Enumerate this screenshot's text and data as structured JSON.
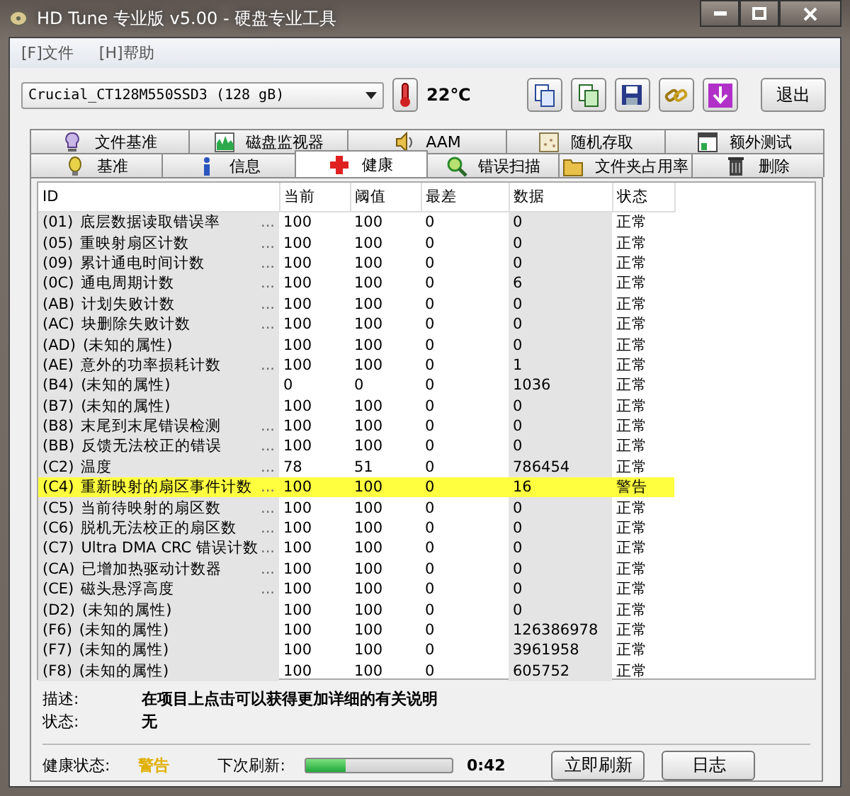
{
  "window": {
    "title": "HD Tune 专业版 v5.00 - 硬盘专业工具"
  },
  "menu": [
    {
      "label": "[F]文件"
    },
    {
      "label": "[H]帮助"
    }
  ],
  "drive_select": {
    "value": "Crucial_CT128M550SSD3 (128 gB)"
  },
  "temperature": "22℃",
  "exit_button": "退出",
  "tab_rows": [
    [
      {
        "label": "文件基准",
        "selected": false
      },
      {
        "label": "磁盘监视器",
        "selected": false
      },
      {
        "label": "AAM",
        "selected": false
      },
      {
        "label": "随机存取",
        "selected": false
      },
      {
        "label": "额外测试",
        "selected": false
      }
    ],
    [
      {
        "label": "基准",
        "selected": false
      },
      {
        "label": "信息",
        "selected": false
      },
      {
        "label": "健康",
        "selected": true
      },
      {
        "label": "错误扫描",
        "selected": false
      },
      {
        "label": "文件夹占用率",
        "selected": false
      },
      {
        "label": "删除",
        "selected": false
      }
    ]
  ],
  "table": {
    "columns": [
      "ID",
      "当前",
      "阈值",
      "最差",
      "数据",
      "状态"
    ],
    "rows": [
      {
        "id": "(01)",
        "name": "底层数据读取错误率",
        "more": "...",
        "current": "100",
        "threshold": "100",
        "worst": "0",
        "data": "0",
        "status": "正常",
        "highlighted": false
      },
      {
        "id": "(05)",
        "name": "重映射扇区计数",
        "more": "...",
        "current": "100",
        "threshold": "100",
        "worst": "0",
        "data": "0",
        "status": "正常",
        "highlighted": false
      },
      {
        "id": "(09)",
        "name": "累计通电时间计数",
        "more": "...",
        "current": "100",
        "threshold": "100",
        "worst": "0",
        "data": "0",
        "status": "正常",
        "highlighted": false
      },
      {
        "id": "(0C)",
        "name": "通电周期计数",
        "more": "...",
        "current": "100",
        "threshold": "100",
        "worst": "0",
        "data": "6",
        "status": "正常",
        "highlighted": false
      },
      {
        "id": "(AB)",
        "name": "计划失败计数",
        "more": "...",
        "current": "100",
        "threshold": "100",
        "worst": "0",
        "data": "0",
        "status": "正常",
        "highlighted": false
      },
      {
        "id": "(AC)",
        "name": "块删除失败计数",
        "more": "...",
        "current": "100",
        "threshold": "100",
        "worst": "0",
        "data": "0",
        "status": "正常",
        "highlighted": false
      },
      {
        "id": "(AD)",
        "name": "(未知的属性)",
        "current": "100",
        "threshold": "100",
        "worst": "0",
        "data": "0",
        "status": "正常",
        "highlighted": false
      },
      {
        "id": "(AE)",
        "name": "意外的功率损耗计数",
        "more": "...",
        "current": "100",
        "threshold": "100",
        "worst": "0",
        "data": "1",
        "status": "正常",
        "highlighted": false
      },
      {
        "id": "(B4)",
        "name": "(未知的属性)",
        "current": "0",
        "threshold": "0",
        "worst": "0",
        "data": "1036",
        "status": "正常",
        "highlighted": false
      },
      {
        "id": "(B7)",
        "name": "(未知的属性)",
        "current": "100",
        "threshold": "100",
        "worst": "0",
        "data": "0",
        "status": "正常",
        "highlighted": false
      },
      {
        "id": "(B8)",
        "name": "末尾到末尾错误检测",
        "more": "...",
        "current": "100",
        "threshold": "100",
        "worst": "0",
        "data": "0",
        "status": "正常",
        "highlighted": false
      },
      {
        "id": "(BB)",
        "name": "反馈无法校正的错误",
        "more": "...",
        "current": "100",
        "threshold": "100",
        "worst": "0",
        "data": "0",
        "status": "正常",
        "highlighted": false
      },
      {
        "id": "(C2)",
        "name": "温度",
        "more": "...",
        "current": "78",
        "threshold": "51",
        "worst": "0",
        "data": "786454",
        "status": "正常",
        "highlighted": false
      },
      {
        "id": "(C4)",
        "name": "重新映射的扇区事件计数",
        "more": "...",
        "current": "100",
        "threshold": "100",
        "worst": "0",
        "data": "16",
        "status": "警告",
        "highlighted": true
      },
      {
        "id": "(C5)",
        "name": "当前待映射的扇区数",
        "more": "...",
        "current": "100",
        "threshold": "100",
        "worst": "0",
        "data": "0",
        "status": "正常",
        "highlighted": false
      },
      {
        "id": "(C6)",
        "name": "脱机无法校正的扇区数",
        "more": "...",
        "current": "100",
        "threshold": "100",
        "worst": "0",
        "data": "0",
        "status": "正常",
        "highlighted": false
      },
      {
        "id": "(C7)",
        "name": "Ultra DMA CRC 错误计数",
        "more": "...",
        "current": "100",
        "threshold": "100",
        "worst": "0",
        "data": "0",
        "status": "正常",
        "highlighted": false
      },
      {
        "id": "(CA)",
        "name": "已增加热驱动计数器",
        "more": "...",
        "current": "100",
        "threshold": "100",
        "worst": "0",
        "data": "0",
        "status": "正常",
        "highlighted": false
      },
      {
        "id": "(CE)",
        "name": "磁头悬浮高度",
        "more": "...",
        "current": "100",
        "threshold": "100",
        "worst": "0",
        "data": "0",
        "status": "正常",
        "highlighted": false
      },
      {
        "id": "(D2)",
        "name": "(未知的属性)",
        "current": "100",
        "threshold": "100",
        "worst": "0",
        "data": "0",
        "status": "正常",
        "highlighted": false
      },
      {
        "id": "(F6)",
        "name": "(未知的属性)",
        "current": "100",
        "threshold": "100",
        "worst": "0",
        "data": "126386978",
        "status": "正常",
        "highlighted": false
      },
      {
        "id": "(F7)",
        "name": "(未知的属性)",
        "current": "100",
        "threshold": "100",
        "worst": "0",
        "data": "3961958",
        "status": "正常",
        "highlighted": false
      },
      {
        "id": "(F8)",
        "name": "(未知的属性)",
        "current": "100",
        "threshold": "100",
        "worst": "0",
        "data": "605752",
        "status": "正常",
        "highlighted": false
      }
    ]
  },
  "details": [
    {
      "label": "描述:",
      "text": "在项目上点击可以获得更加详细的有关说明"
    },
    {
      "label": "状态:",
      "text": "无"
    }
  ],
  "footer": {
    "health_label": "健康状态:",
    "health_value": "警告",
    "health_warning": true,
    "refresh_label": "下次刷新:",
    "level": 0.27,
    "countdown": "0:42",
    "buttons": [
      "立即刷新",
      "日志"
    ]
  }
}
